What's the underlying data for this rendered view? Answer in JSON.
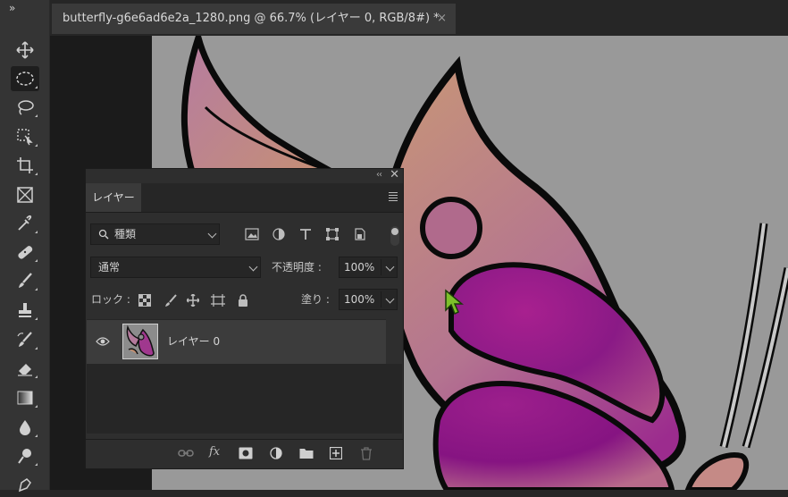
{
  "toolbar": {
    "collapse_glyph": "»",
    "tools": [
      {
        "name": "move-tool",
        "icon": "move-icon"
      },
      {
        "name": "elliptical-marquee-tool",
        "icon": "ellipse-marquee-icon",
        "active": true
      },
      {
        "name": "lasso-tool",
        "icon": "lasso-icon"
      },
      {
        "name": "object-selection-tool",
        "icon": "object-selection-icon"
      },
      {
        "name": "crop-tool",
        "icon": "crop-icon"
      },
      {
        "name": "frame-tool",
        "icon": "frame-icon"
      },
      {
        "name": "eyedropper-tool",
        "icon": "eyedropper-icon"
      },
      {
        "name": "healing-brush-tool",
        "icon": "bandage-icon"
      },
      {
        "name": "brush-tool",
        "icon": "brush-icon"
      },
      {
        "name": "clone-stamp-tool",
        "icon": "stamp-icon"
      },
      {
        "name": "history-brush-tool",
        "icon": "history-brush-icon"
      },
      {
        "name": "eraser-tool",
        "icon": "eraser-icon"
      },
      {
        "name": "gradient-tool",
        "icon": "gradient-icon"
      },
      {
        "name": "blur-tool",
        "icon": "drop-icon"
      },
      {
        "name": "dodge-tool",
        "icon": "dodge-icon"
      },
      {
        "name": "pen-tool",
        "icon": "pen-icon"
      }
    ]
  },
  "document": {
    "tab_title": "butterfly-g6e6ad6e2a_1280.png @ 66.7% (レイヤー 0, RGB/8#) *",
    "close_glyph": "×"
  },
  "layers_panel": {
    "collapse_glyph": "‹‹",
    "close_glyph": "✕",
    "tab_label": "レイヤー",
    "filter_placeholder": "種類",
    "blend_mode": "通常",
    "opacity_label": "不透明度 :",
    "opacity_value": "100%",
    "lock_label": "ロック :",
    "fill_label": "塗り :",
    "fill_value": "100%",
    "layers": [
      {
        "name": "レイヤー 0",
        "visible": true,
        "selected": true
      }
    ],
    "footer_fx": "fx"
  },
  "colors": {
    "toolbar_bg": "#343434",
    "panel_bg": "#2e2e2e",
    "canvas_bg": "#999999",
    "butterfly_magenta": "#8e1a8e",
    "butterfly_peach": "#c89070",
    "cursor_green": "#7dbf2a"
  }
}
